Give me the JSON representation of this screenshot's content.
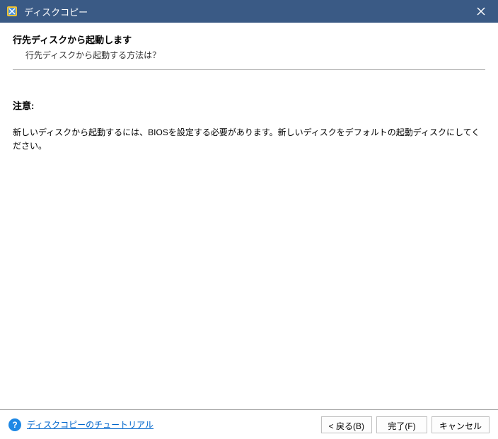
{
  "titlebar": {
    "title": "ディスクコピー"
  },
  "content": {
    "heading": "行先ディスクから起動します",
    "subheading": "行先ディスクから起動する方法は？",
    "note_label": "注意:",
    "note_text": "新しいディスクから起動するには、BIOSを設定する必要があります。新しいディスクをデフォルトの起動ディスクにしてください。"
  },
  "footer": {
    "tutorial_link": "ディスクコピーのチュートリアル",
    "back_button": "< 戻る(B)",
    "finish_button": "完了(F)",
    "cancel_button": "キャンセル"
  }
}
